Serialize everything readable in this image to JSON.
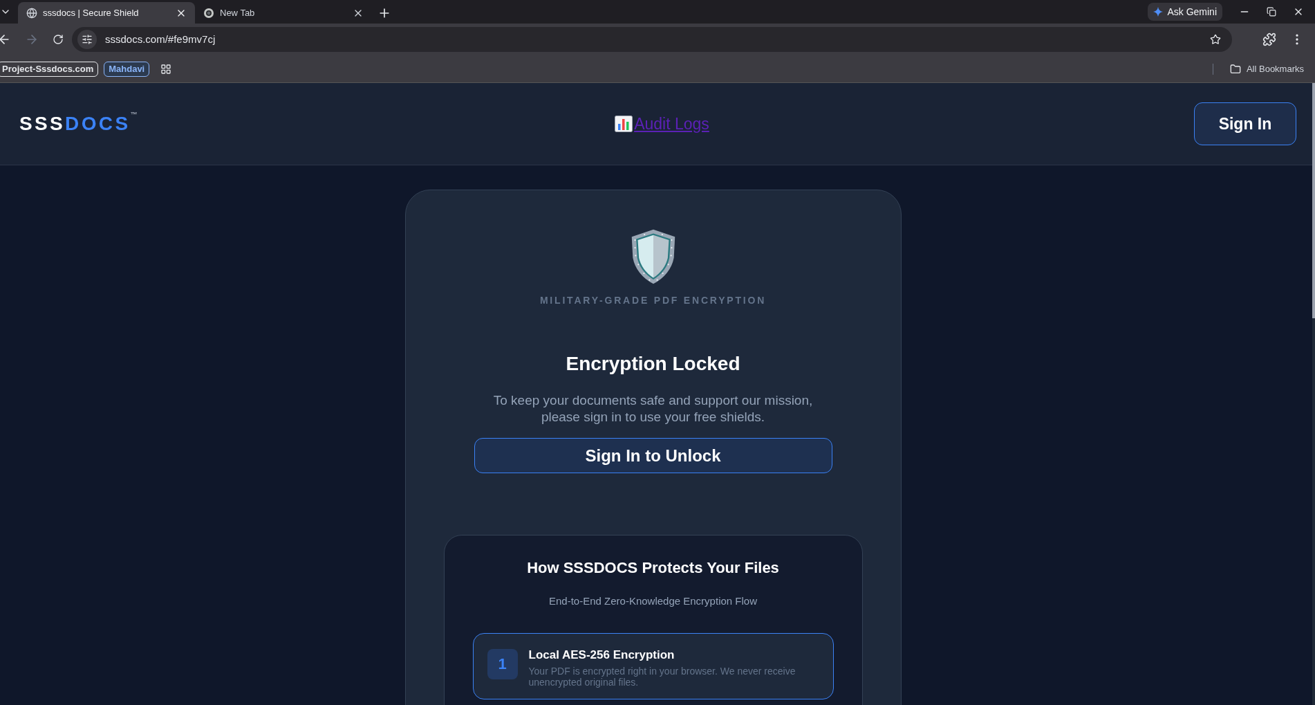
{
  "browser": {
    "tabs": [
      {
        "title": "sssdocs | Secure Shield",
        "selected": true,
        "kind": "globe"
      },
      {
        "title": "New Tab",
        "selected": false,
        "kind": "browser"
      }
    ],
    "ask_button": "Ask Gemini",
    "address": "sssdocs.com/#fe9mv7cj",
    "bookmarks": [
      {
        "label": "Project-Sssdocs.com",
        "color": "#e5e7eb"
      },
      {
        "label": "Mahdavi",
        "color": "#8ab4f8"
      }
    ],
    "all_bookmarks": "All Bookmarks"
  },
  "header": {
    "logo": {
      "first": "SSS",
      "second": "DOCS",
      "mark": "™"
    },
    "nav_link": "Audit Logs",
    "sign_in": "Sign In"
  },
  "card": {
    "tagline": "MILITARY-GRADE PDF ENCRYPTION",
    "title": "Encryption Locked",
    "message": "To keep your documents safe and support our mission, please sign in to use your free shields.",
    "button": "Sign In to Unlock",
    "how": {
      "title": "How SSSDOCS Protects Your Files",
      "subtitle": "End-to-End Zero-Knowledge Encryption Flow",
      "steps": [
        {
          "number": "1",
          "title": "Local AES-256 Encryption",
          "text": "Your PDF is encrypted right in your browser. We never receive unencrypted original files."
        }
      ]
    }
  }
}
